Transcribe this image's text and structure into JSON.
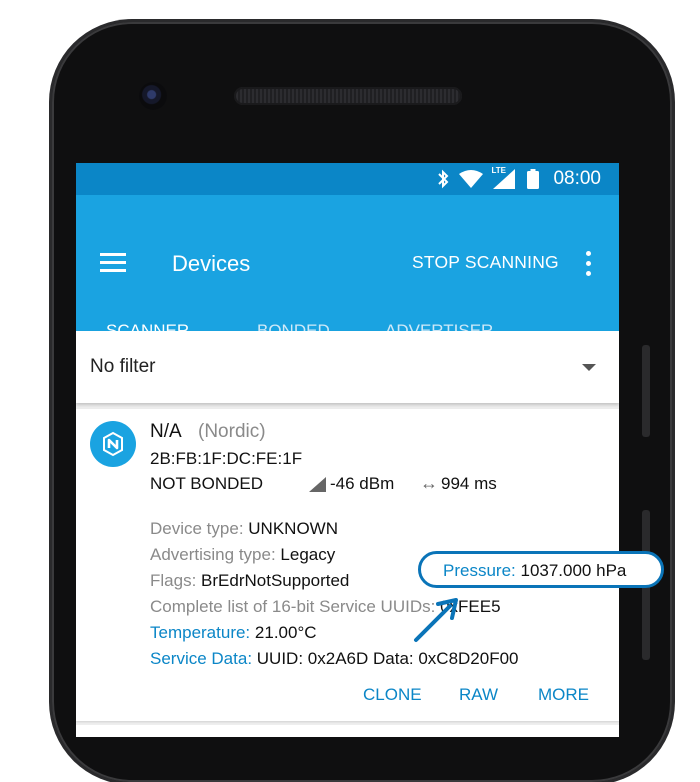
{
  "status_bar": {
    "time": "08:00",
    "network": "LTE",
    "icons": [
      "bluetooth-icon",
      "wifi-icon",
      "cell-signal-icon",
      "battery-icon"
    ]
  },
  "app_bar": {
    "title": "Devices",
    "action": "STOP SCANNING",
    "tabs": [
      {
        "label": "SCANNER",
        "active": true
      },
      {
        "label": "BONDED",
        "active": false
      },
      {
        "label": "ADVERTISER",
        "active": false
      }
    ]
  },
  "filter": {
    "selected": "No filter"
  },
  "device": {
    "name": "N/A",
    "vendor": "(Nordic)",
    "address": "2B:FB:1F:DC:FE:1F",
    "bond_state": "NOT BONDED",
    "rssi": "-46 dBm",
    "interval": "994 ms",
    "details": {
      "device_type_label": "Device type:",
      "device_type": "UNKNOWN",
      "advertising_type_label": "Advertising type:",
      "advertising_type": "Legacy",
      "flags_label": "Flags:",
      "flags": "BrEdrNotSupported",
      "services_label": "Complete list of 16-bit Service UUIDs:",
      "services": "0xFEE5",
      "temperature_label": "Temperature:",
      "temperature": "21.00°C",
      "service_data_label": "Service Data:",
      "service_data": "UUID: 0x2A6D Data: 0xC8D20F00"
    },
    "actions": [
      "CLONE",
      "RAW",
      "MORE"
    ]
  },
  "callout": {
    "label": "Pressure:",
    "value": "1037.000 hPa"
  },
  "colors": {
    "status_bar": "#0b86c7",
    "app_bar": "#1aa3e1",
    "accent": "#0b86c7",
    "callout_border": "#0a74b8"
  }
}
